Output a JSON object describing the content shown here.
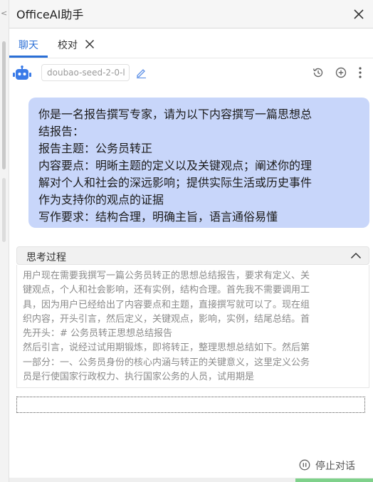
{
  "app": {
    "title": "OfficeAI助手"
  },
  "tabs": [
    {
      "label": "聊天",
      "active": true
    },
    {
      "label": "校对",
      "active": false
    }
  ],
  "toolbar": {
    "model_name": "doubao-seed-2-0-l"
  },
  "user_message": {
    "lines": [
      "你是一名报告撰写专家，请为以下内容撰写一篇思想总",
      "结报告：",
      "报告主题：公务员转正",
      "内容要点：明晰主题的定义以及关键观点；阐述你的理",
      "解对个人和社会的深远影响；提供实际生活或历史事件",
      "作为支持你的观点的证据",
      "写作要求：结构合理，明确主旨，语言通俗易懂"
    ]
  },
  "thinking": {
    "label": "思考过程",
    "lines": [
      "用户现在需要我撰写一篇公务员转正的思想总结报告，要求有定义、关",
      "键观点，个人和社会影响，还有实例，结构合理。首先我不需要调用工",
      "具，因为用户已经给出了内容要点和主题，直接撰写就可以了。现在组",
      "织内容，开头引言，然后定义，关键观点，影响，实例，结尾总结。首",
      "先开头：# 公务员转正思想总结报告",
      "然后引言，说经过试用期锻炼，即将转正，整理思想总结如下。然后第",
      "一部分：一、公务员身份的核心内涵与转正的关键意义，这里定义公务",
      "员是行使国家行政权力、执行国家公务的人员，试用期是"
    ]
  },
  "footer": {
    "stop_label": "停止对话"
  },
  "colors": {
    "accent": "#2b6fd6",
    "bubble": "#c8d6fa",
    "bot_icon": "#3a7be8",
    "progress": "#7fd18b"
  }
}
